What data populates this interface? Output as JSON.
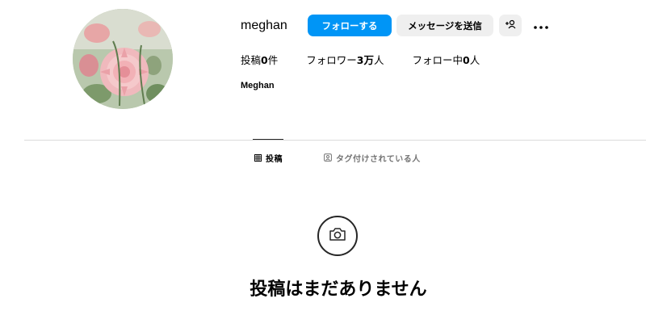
{
  "profile": {
    "username": "meghan",
    "full_name": "Meghan",
    "avatar": "avatar-icon"
  },
  "actions": {
    "follow_label": "フォローする",
    "message_label": "メッセージを送信",
    "suggest_icon": "add-person-icon",
    "more_icon": "more-options-icon"
  },
  "stats": {
    "posts_label": "投稿",
    "posts_value": "0",
    "posts_suffix": "件",
    "followers_label": "フォロワー",
    "followers_value": "3万",
    "followers_suffix": "人",
    "following_label": "フォロー中",
    "following_value": "0",
    "following_suffix": "人"
  },
  "tabs": [
    {
      "label": "投稿",
      "icon": "grid-icon",
      "active": true
    },
    {
      "label": "タグ付けされている人",
      "icon": "tagged-icon",
      "active": false
    }
  ],
  "empty_state": {
    "icon": "camera-icon",
    "title": "投稿はまだありません"
  },
  "colors": {
    "primary": "#0095f6",
    "secondary_button": "#efefef",
    "divider": "#dbdbdb",
    "muted_text": "#737373"
  }
}
